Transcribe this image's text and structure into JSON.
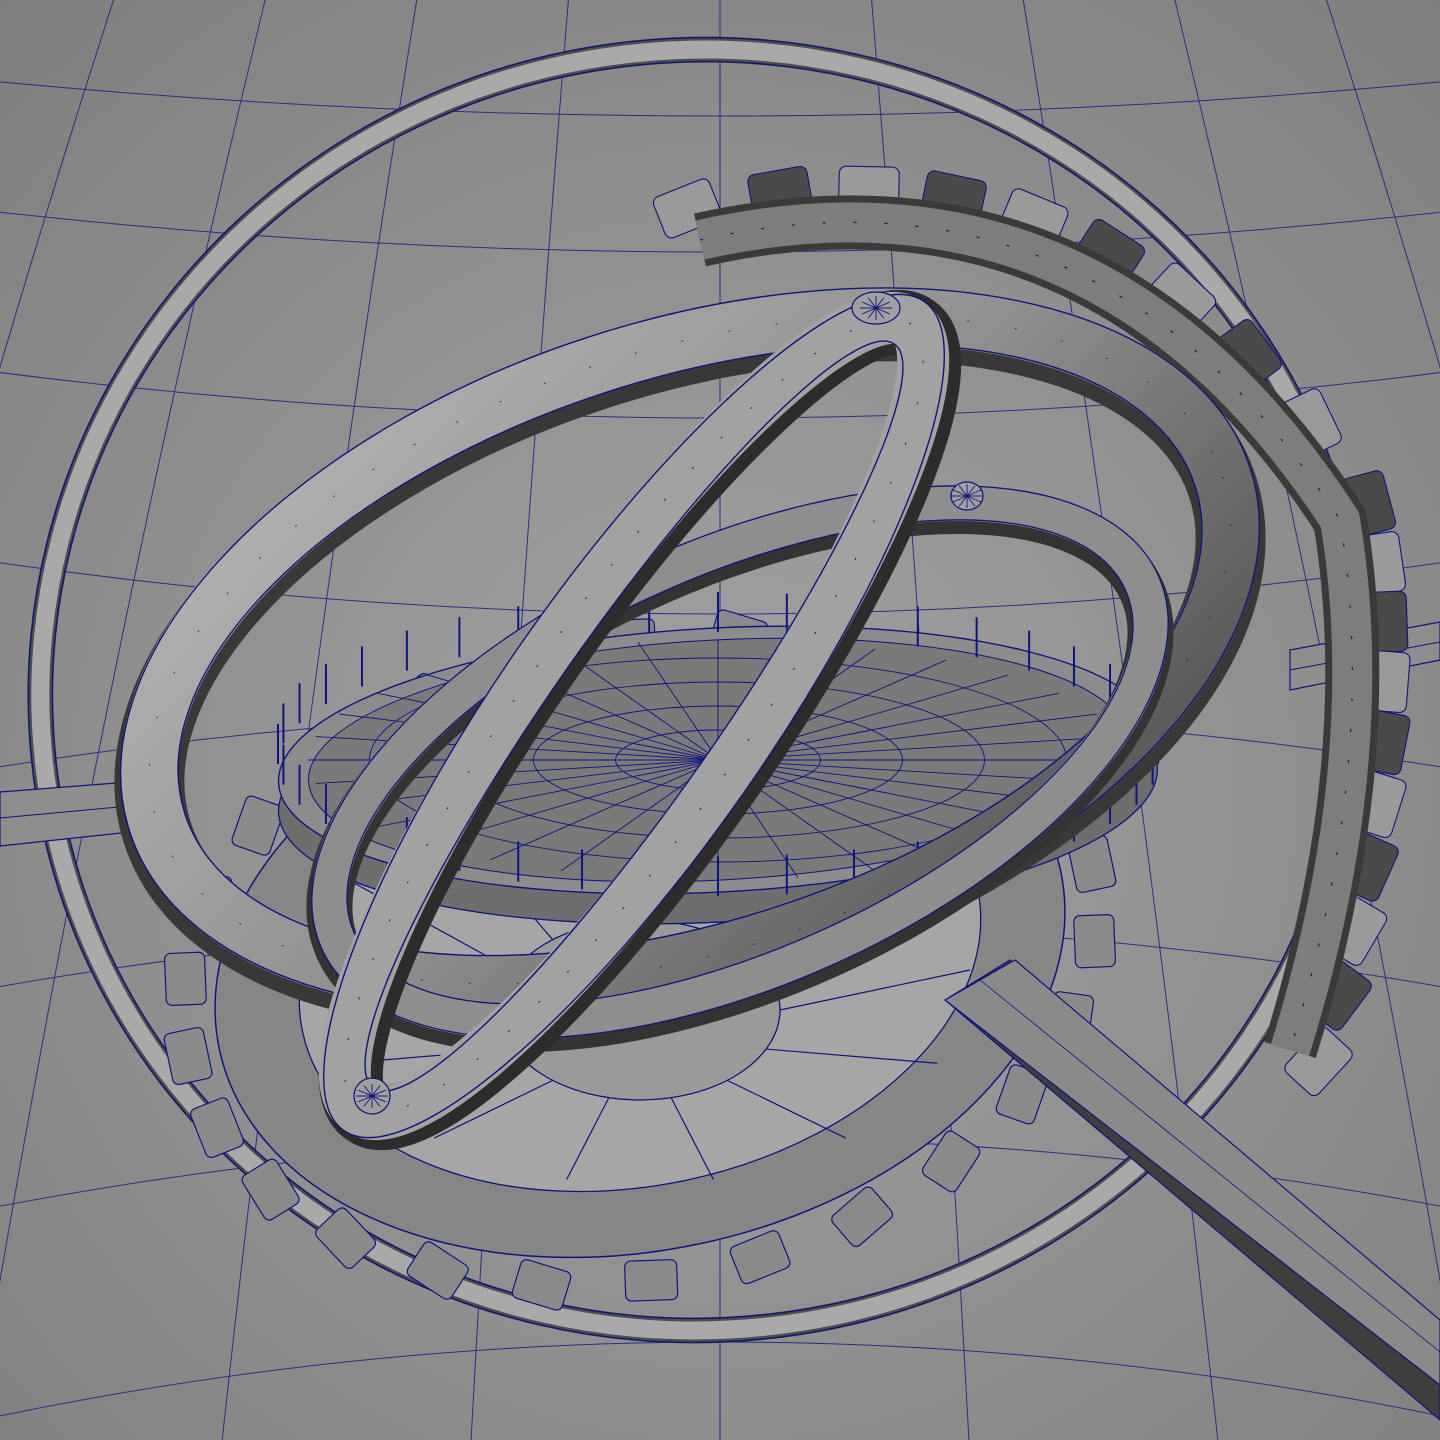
{
  "viewport": {
    "background_color": "#8a8a8a",
    "background_gradient_center": "#a2a2a2",
    "wire_color": "#10147e",
    "dark_shade": "#2e2e2e",
    "mid_shade": "#7a7a7a",
    "light_shade": "#b4b4b4"
  },
  "scene": {
    "view_mode": "shaded-wireframe",
    "objects": [
      {
        "name": "outer-ring"
      },
      {
        "name": "gimbal-ring-large"
      },
      {
        "name": "gimbal-ring-diagonal"
      },
      {
        "name": "gimbal-ring-inner"
      },
      {
        "name": "spur-gear-lower"
      },
      {
        "name": "spur-gear-upper"
      },
      {
        "name": "central-disc"
      },
      {
        "name": "axle-horizontal"
      },
      {
        "name": "handle-arm"
      },
      {
        "name": "pivot-bolts"
      }
    ]
  }
}
